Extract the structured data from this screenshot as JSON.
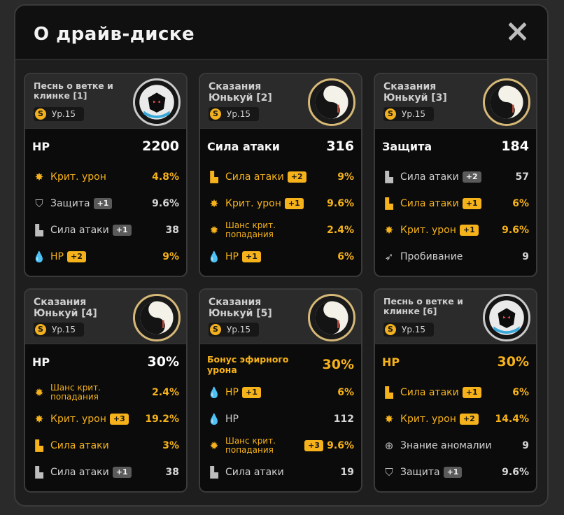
{
  "title": "О драйв-диске",
  "close_icon": "close-icon",
  "colors": {
    "accent": "#f6b21b",
    "background": "#1e1e1e",
    "card": "#0b0b0b"
  },
  "cards": [
    {
      "name": "Песнь о ветке и клинке [1]",
      "level": "Ур.15",
      "disc": "blade-song",
      "main": {
        "label": "HP",
        "value": "2200"
      },
      "subs": [
        {
          "icon": "crit-dmg-icon",
          "label": "Крит. урон",
          "badge": "",
          "value": "4.8%",
          "active": true
        },
        {
          "icon": "shield-icon",
          "label": "Защита",
          "badge": "+1",
          "value": "9.6%",
          "active": false
        },
        {
          "icon": "fist-icon",
          "label": "Сила атаки",
          "badge": "+1",
          "value": "38",
          "active": false
        },
        {
          "icon": "drop-icon",
          "label": "HP",
          "badge": "+2",
          "value": "9%",
          "active": true
        }
      ]
    },
    {
      "name": "Сказания Юнькуй [2]",
      "level": "Ур.15",
      "disc": "yunkui",
      "main": {
        "label": "Сила атаки",
        "value": "316"
      },
      "subs": [
        {
          "icon": "fist-icon",
          "label": "Сила атаки",
          "badge": "+2",
          "value": "9%",
          "active": true
        },
        {
          "icon": "crit-dmg-icon",
          "label": "Крит. урон",
          "badge": "+1",
          "value": "9.6%",
          "active": true
        },
        {
          "icon": "crit-rate-icon",
          "label": "Шанс крит. попадания",
          "badge": "",
          "value": "2.4%",
          "active": true
        },
        {
          "icon": "drop-icon",
          "label": "HP",
          "badge": "+1",
          "value": "6%",
          "active": true
        }
      ]
    },
    {
      "name": "Сказания Юнькуй [3]",
      "level": "Ур.15",
      "disc": "yunkui",
      "main": {
        "label": "Защита",
        "value": "184"
      },
      "subs": [
        {
          "icon": "fist-icon",
          "label": "Сила атаки",
          "badge": "+2",
          "value": "57",
          "active": false
        },
        {
          "icon": "fist-icon",
          "label": "Сила атаки",
          "badge": "+1",
          "value": "6%",
          "active": true
        },
        {
          "icon": "crit-dmg-icon",
          "label": "Крит. урон",
          "badge": "+1",
          "value": "9.6%",
          "active": true
        },
        {
          "icon": "pen-icon",
          "label": "Пробивание",
          "badge": "",
          "value": "9",
          "active": false
        }
      ]
    },
    {
      "name": "Сказания Юнькуй [4]",
      "level": "Ур.15",
      "disc": "yunkui",
      "main": {
        "label": "HP",
        "value": "30%"
      },
      "subs": [
        {
          "icon": "crit-rate-icon",
          "label": "Шанс крит. попадания",
          "badge": "",
          "value": "2.4%",
          "active": true
        },
        {
          "icon": "crit-dmg-icon",
          "label": "Крит. урон",
          "badge": "+3",
          "value": "19.2%",
          "active": true
        },
        {
          "icon": "fist-icon",
          "label": "Сила атаки",
          "badge": "",
          "value": "3%",
          "active": true
        },
        {
          "icon": "fist-icon",
          "label": "Сила атаки",
          "badge": "+1",
          "value": "38",
          "active": false
        }
      ]
    },
    {
      "name": "Сказания Юнькуй [5]",
      "level": "Ур.15",
      "disc": "yunkui",
      "main": {
        "label": "Бонус эфирного урона",
        "value": "30%",
        "gold": true
      },
      "subs": [
        {
          "icon": "drop-icon",
          "label": "HP",
          "badge": "+1",
          "value": "6%",
          "active": true
        },
        {
          "icon": "drop-icon",
          "label": "HP",
          "badge": "",
          "value": "112",
          "active": false
        },
        {
          "icon": "crit-rate-icon",
          "label": "Шанс крит. попадания",
          "badge": "+3",
          "value": "9.6%",
          "active": true
        },
        {
          "icon": "fist-icon",
          "label": "Сила атаки",
          "badge": "",
          "value": "19",
          "active": false
        }
      ]
    },
    {
      "name": "Песнь о ветке и клинке [6]",
      "level": "Ур.15",
      "disc": "blade-song",
      "main": {
        "label": "HP",
        "value": "30%",
        "gold": true
      },
      "subs": [
        {
          "icon": "fist-icon",
          "label": "Сила атаки",
          "badge": "+1",
          "value": "6%",
          "active": true
        },
        {
          "icon": "crit-dmg-icon",
          "label": "Крит. урон",
          "badge": "+2",
          "value": "14.4%",
          "active": true
        },
        {
          "icon": "anomaly-icon",
          "label": "Знание аномалии",
          "badge": "",
          "value": "9",
          "active": false
        },
        {
          "icon": "shield-icon",
          "label": "Защита",
          "badge": "+1",
          "value": "9.6%",
          "active": false
        }
      ]
    }
  ]
}
